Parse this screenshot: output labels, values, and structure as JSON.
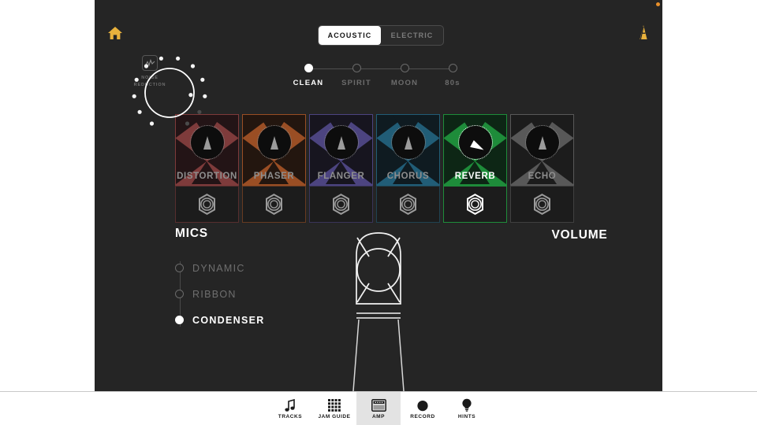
{
  "app": {
    "background_color": "#252525",
    "accent_gold": "#e8b13c",
    "active_green": "#1e8c3a"
  },
  "topbar": {
    "home_icon": "home-icon",
    "metronome_icon": "metronome-icon",
    "notification_dot_color": "#e8902a"
  },
  "amp_type_toggle": {
    "options": [
      {
        "label": "ACOUSTIC",
        "active": true
      },
      {
        "label": "ELECTRIC",
        "active": false
      }
    ]
  },
  "noise_reduction": {
    "icon": "waveform-icon",
    "line1": "NOISE",
    "line2": "REDUCTION"
  },
  "presets": {
    "steps": [
      {
        "label": "CLEAN",
        "active": true
      },
      {
        "label": "SPIRIT",
        "active": false
      },
      {
        "label": "MOON",
        "active": false
      },
      {
        "label": "80s",
        "active": false
      }
    ]
  },
  "effects": {
    "pedals": [
      {
        "name": "DISTORTION",
        "color": "#7e3b3b",
        "dark": "#231416",
        "on": false
      },
      {
        "name": "PHASER",
        "color": "#9a4e24",
        "dark": "#23160f",
        "on": false
      },
      {
        "name": "FLANGER",
        "color": "#4c4480",
        "dark": "#17151f",
        "on": false
      },
      {
        "name": "CHORUS",
        "color": "#215d77",
        "dark": "#0f1b21",
        "on": false
      },
      {
        "name": "REVERB",
        "color": "#1e8c3a",
        "dark": "#0d2615",
        "on": true
      },
      {
        "name": "ECHO",
        "color": "#585858",
        "dark": "#1c1c1c",
        "on": false
      }
    ]
  },
  "mics": {
    "title": "MICS",
    "options": [
      {
        "label": "DYNAMIC",
        "selected": false
      },
      {
        "label": "RIBBON",
        "selected": false
      },
      {
        "label": "CONDENSER",
        "selected": true
      }
    ]
  },
  "microphone_illustration": {
    "icon": "condenser-microphone-icon"
  },
  "volume": {
    "title": "VOLUME",
    "total_dots": 12,
    "lit_dots": 10
  },
  "tabbar": {
    "tabs": [
      {
        "label": "TRACKS",
        "icon": "music-note-icon",
        "active": false
      },
      {
        "label": "JAM GUIDE",
        "icon": "grid-icon",
        "active": false
      },
      {
        "label": "AMP",
        "icon": "amplifier-icon",
        "active": true
      },
      {
        "label": "RECORD",
        "icon": "record-dot-icon",
        "active": false
      },
      {
        "label": "HINTS",
        "icon": "lightbulb-icon",
        "active": false
      }
    ]
  }
}
